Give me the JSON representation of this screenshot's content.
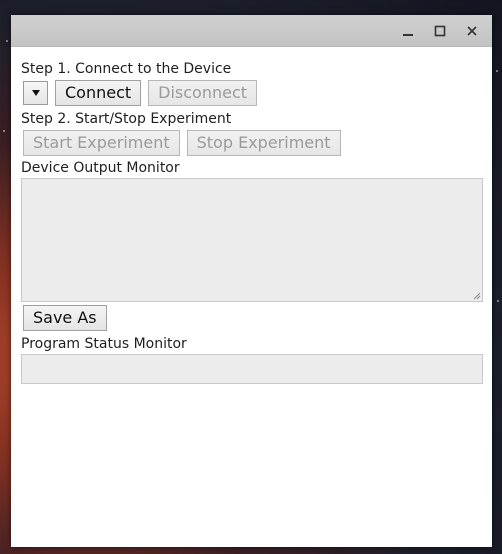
{
  "window": {
    "controls": {
      "minimize_icon": "minimize-icon",
      "maximize_icon": "maximize-icon",
      "close_icon": "close-icon"
    }
  },
  "step1": {
    "label": "Step 1. Connect to the Device",
    "port_dropdown_selected": "",
    "connect_label": "Connect",
    "disconnect_label": "Disconnect"
  },
  "step2": {
    "label": "Step 2. Start/Stop Experiment",
    "start_label": "Start Experiment",
    "stop_label": "Stop Experiment"
  },
  "device_output": {
    "label": "Device Output Monitor",
    "value": "",
    "save_as_label": "Save As"
  },
  "program_status": {
    "label": "Program Status Monitor",
    "value": ""
  },
  "colors": {
    "titlebar": "#c6c6c6",
    "field_background": "#ececec",
    "disabled_text": "#9a9a9a"
  }
}
